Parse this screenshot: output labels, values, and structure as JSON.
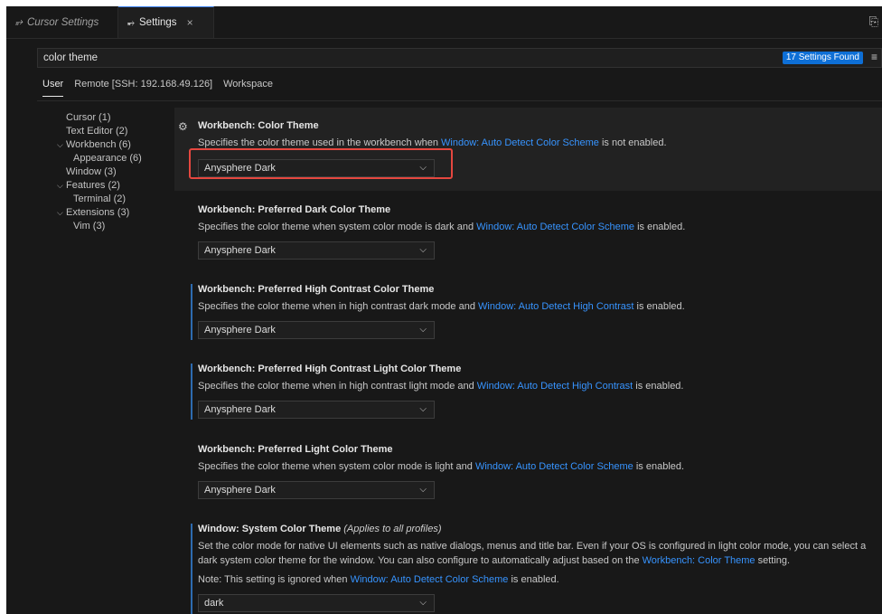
{
  "tabs": [
    {
      "label": "Cursor Settings",
      "icon": "settings-sliders-icon"
    },
    {
      "label": "Settings",
      "icon": "settings-sliders-icon",
      "close": "×"
    }
  ],
  "search": {
    "value": "color theme",
    "count": "17 Settings Found"
  },
  "scope_tabs": [
    "User",
    "Remote [SSH: 192.168.49.126]",
    "Workspace"
  ],
  "toc": [
    {
      "label": "Cursor (1)",
      "indent": 1,
      "chevron": ""
    },
    {
      "label": "Text Editor (2)",
      "indent": 1,
      "chevron": ""
    },
    {
      "label": "Workbench (6)",
      "indent": 0,
      "chevron": "⌵"
    },
    {
      "label": "Appearance (6)",
      "indent": 2,
      "chevron": ""
    },
    {
      "label": "Window (3)",
      "indent": 1,
      "chevron": ""
    },
    {
      "label": "Features (2)",
      "indent": 0,
      "chevron": "⌵"
    },
    {
      "label": "Terminal (2)",
      "indent": 2,
      "chevron": ""
    },
    {
      "label": "Extensions (3)",
      "indent": 0,
      "chevron": "⌵"
    },
    {
      "label": "Vim (3)",
      "indent": 2,
      "chevron": ""
    }
  ],
  "settings": [
    {
      "title": "Workbench: Color Theme",
      "desc_pre": "Specifies the color theme used in the workbench when ",
      "desc_link": "Window: Auto Detect Color Scheme",
      "desc_post": " is not enabled.",
      "value": "Anysphere Dark"
    },
    {
      "title": "Workbench: Preferred Dark Color Theme",
      "desc_pre": "Specifies the color theme when system color mode is dark and ",
      "desc_link": "Window: Auto Detect Color Scheme",
      "desc_post": " is enabled.",
      "value": "Anysphere Dark"
    },
    {
      "title": "Workbench: Preferred High Contrast Color Theme",
      "desc_pre": "Specifies the color theme when in high contrast dark mode and ",
      "desc_link": "Window: Auto Detect High Contrast",
      "desc_post": " is enabled.",
      "value": "Anysphere Dark"
    },
    {
      "title": "Workbench: Preferred High Contrast Light Color Theme",
      "desc_pre": "Specifies the color theme when in high contrast light mode and ",
      "desc_link": "Window: Auto Detect High Contrast",
      "desc_post": " is enabled.",
      "value": "Anysphere Dark"
    },
    {
      "title": "Workbench: Preferred Light Color Theme",
      "desc_pre": "Specifies the color theme when system color mode is light and ",
      "desc_link": "Window: Auto Detect Color Scheme",
      "desc_post": " is enabled.",
      "value": "Anysphere Dark"
    }
  ],
  "system_theme": {
    "title": "Window: System Color Theme",
    "scope_note": "(Applies to all profiles)",
    "desc_line1": "Set the color mode for native UI elements such as native dialogs, menus and title bar. Even if your OS is configured in light color mode, you can select a",
    "desc_line2_pre": "dark system color theme for the window. You can also configure to automatically adjust based on the ",
    "desc_line2_link": "Workbench: Color Theme",
    "desc_line2_post": " setting.",
    "note_pre": "Note: This setting is ignored when ",
    "note_link": "Window: Auto Detect Color Scheme",
    "note_post": " is enabled.",
    "value": "dark"
  },
  "colors": {
    "accent": "#3794ff",
    "badge": "#0e6fd6",
    "highlight": "#e5473f",
    "background": "#181818"
  }
}
